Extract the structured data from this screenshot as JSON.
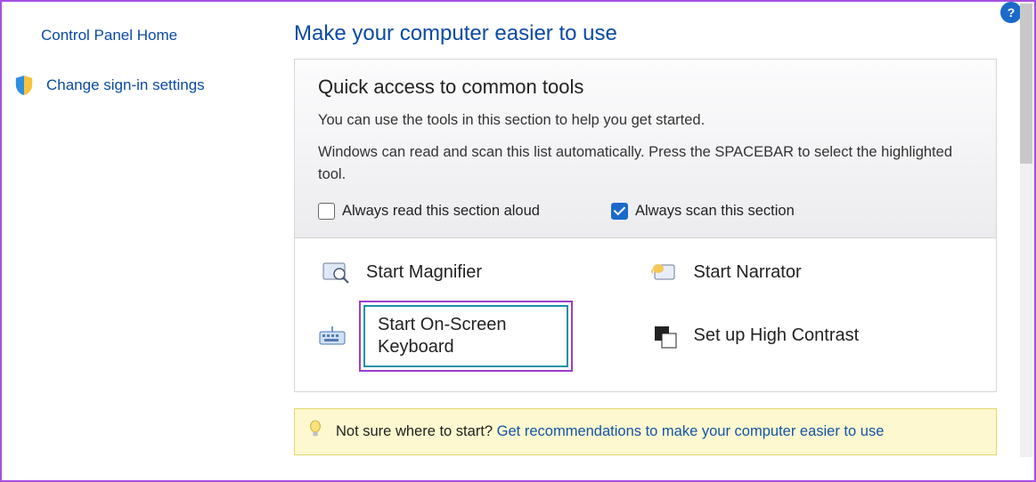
{
  "sidebar": {
    "home": "Control Panel Home",
    "signin": "Change sign-in settings"
  },
  "main": {
    "title": "Make your computer easier to use",
    "quick": {
      "heading": "Quick access to common tools",
      "intro": "You can use the tools in this section to help you get started.",
      "scan_note": "Windows can read and scan this list automatically.  Press the SPACEBAR to select the highlighted tool.",
      "cb_read": "Always read this section aloud",
      "cb_scan": "Always scan this section"
    },
    "tools": {
      "magnifier": "Start Magnifier",
      "narrator": "Start Narrator",
      "osk": "Start On-Screen Keyboard",
      "high_contrast": "Set up High Contrast"
    },
    "recommend": {
      "prefix": "Not sure where to start? ",
      "link": "Get recommendations to make your computer easier to use"
    }
  },
  "help_badge": "?"
}
